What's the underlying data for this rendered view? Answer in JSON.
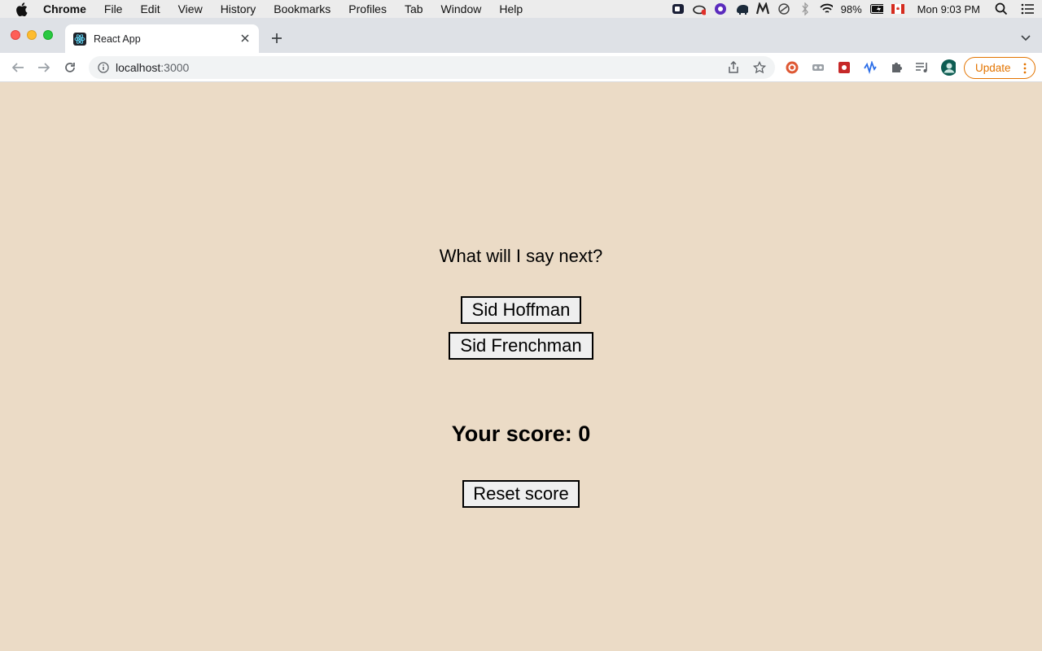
{
  "menubar": {
    "app_name": "Chrome",
    "items": [
      "File",
      "Edit",
      "View",
      "History",
      "Bookmarks",
      "Profiles",
      "Tab",
      "Window",
      "Help"
    ],
    "battery": "98%",
    "clock": "Mon 9:03 PM"
  },
  "browser": {
    "tab_title": "React App",
    "url_host": "localhost",
    "url_port": ":3000",
    "update_label": "Update",
    "accent_color": "#e37400"
  },
  "page": {
    "background": "#ebdbc6",
    "question": "What will I say next?",
    "answers": [
      "Sid Hoffman",
      "Sid Frenchman"
    ],
    "score_text": "Your score: 0",
    "reset_label": "Reset score"
  }
}
